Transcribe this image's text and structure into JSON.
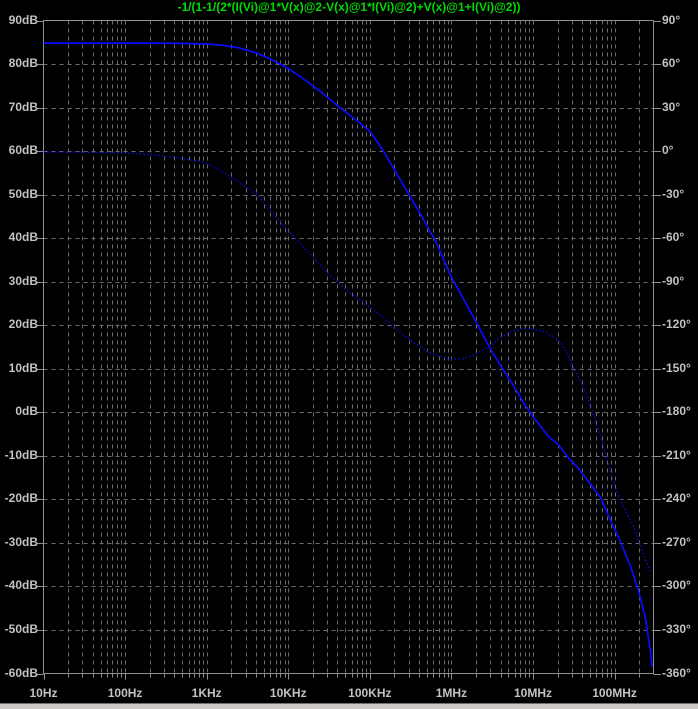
{
  "title": {
    "text": "-1/(1-1/(2*(I(Vi)@1*V(x)@2-V(x)@1*I(Vi)@2)+V(x)@1+I(Vi)@2))",
    "color": "#00dc00"
  },
  "colors": {
    "background": "#000000",
    "trace_blue": "#0b0bff",
    "grid": "#6e6e6e",
    "axis_border": "#909090",
    "tick": "#909090",
    "label": "#c2c2c2",
    "bottom_strip": "#cdcac5"
  },
  "chart_data": {
    "type": "line",
    "title": "-1/(1-1/(2*(I(Vi)@1*V(x)@2-V(x)@1*I(Vi)@2)+V(x)@1+I(Vi)@2))",
    "x_axis": {
      "scale": "log",
      "unit": "Hz",
      "log10_range": [
        1.0,
        8.4771
      ],
      "tick_labels": [
        "10Hz",
        "100Hz",
        "1KHz",
        "10KHz",
        "100KHz",
        "1MHz",
        "10MHz",
        "100MHz"
      ],
      "tick_log10_positions": [
        1,
        2,
        3,
        4,
        5,
        6,
        7,
        8
      ]
    },
    "y_axis_left": {
      "unit": "dB",
      "range": [
        -60,
        90
      ],
      "step": 10,
      "tick_labels": [
        "90dB",
        "80dB",
        "70dB",
        "60dB",
        "50dB",
        "40dB",
        "30dB",
        "20dB",
        "10dB",
        "0dB",
        "-10dB",
        "-20dB",
        "-30dB",
        "-40dB",
        "-50dB",
        "-60dB"
      ]
    },
    "y_axis_right": {
      "unit": "degrees",
      "range": [
        -360,
        90
      ],
      "step": 30,
      "tick_labels": [
        "90°",
        "60°",
        "30°",
        "0°",
        "-30°",
        "-60°",
        "-90°",
        "-120°",
        "-150°",
        "-180°",
        "-210°",
        "-240°",
        "-270°",
        "-300°",
        "-330°",
        "-360°"
      ]
    },
    "grid": {
      "horizontal": true,
      "vertical_major": true,
      "vertical_minor_log": true,
      "style": "dashed"
    },
    "legend": "none",
    "series": [
      {
        "name": "magnitude",
        "axis": "left",
        "style": "solid",
        "color": "#0b0bff",
        "points_log10f_db": [
          [
            1.0,
            84.8
          ],
          [
            1.5,
            84.8
          ],
          [
            2.0,
            84.8
          ],
          [
            2.4,
            84.8
          ],
          [
            2.7,
            84.75
          ],
          [
            3.0,
            84.6
          ],
          [
            3.2,
            84.3
          ],
          [
            3.4,
            83.7
          ],
          [
            3.6,
            82.6
          ],
          [
            3.8,
            81.0
          ],
          [
            4.0,
            79.0
          ],
          [
            4.2,
            76.4
          ],
          [
            4.4,
            73.6
          ],
          [
            4.6,
            70.5
          ],
          [
            4.8,
            67.6
          ],
          [
            5.0,
            64.6
          ],
          [
            5.15,
            60.5
          ],
          [
            5.3,
            55.8
          ],
          [
            5.45,
            51.0
          ],
          [
            5.6,
            46.2
          ],
          [
            5.7,
            42.8
          ],
          [
            5.8,
            39.6
          ],
          [
            5.9,
            35.3
          ],
          [
            6.0,
            31.0
          ],
          [
            6.15,
            26.0
          ],
          [
            6.3,
            20.8
          ],
          [
            6.48,
            14.5
          ],
          [
            6.6,
            10.8
          ],
          [
            6.75,
            6.4
          ],
          [
            6.9,
            1.8
          ],
          [
            7.0,
            -1.0
          ],
          [
            7.1,
            -3.4
          ],
          [
            7.2,
            -5.8
          ],
          [
            7.3,
            -7.2
          ],
          [
            7.45,
            -10.8
          ],
          [
            7.55,
            -12.7
          ],
          [
            7.7,
            -16.4
          ],
          [
            7.83,
            -19.6
          ],
          [
            7.95,
            -24.8
          ],
          [
            8.07,
            -29.6
          ],
          [
            8.2,
            -35.6
          ],
          [
            8.3,
            -41.5
          ],
          [
            8.38,
            -47.5
          ],
          [
            8.44,
            -55.0
          ],
          [
            8.46,
            -58.5
          ]
        ]
      },
      {
        "name": "phase",
        "axis": "right",
        "style": "dotted",
        "color": "#0b0bff",
        "points_log10f_deg": [
          [
            1.0,
            -0.6
          ],
          [
            1.6,
            -0.8
          ],
          [
            2.0,
            -1.3
          ],
          [
            2.3,
            -2.3
          ],
          [
            2.6,
            -4.2
          ],
          [
            2.92,
            -7.0
          ],
          [
            3.1,
            -11.0
          ],
          [
            3.33,
            -19.0
          ],
          [
            3.62,
            -30.0
          ],
          [
            3.8,
            -42.0
          ],
          [
            4.0,
            -55.0
          ],
          [
            4.15,
            -64.0
          ],
          [
            4.3,
            -72.5
          ],
          [
            4.48,
            -84.0
          ],
          [
            4.76,
            -98.0
          ],
          [
            5.0,
            -107.5
          ],
          [
            5.13,
            -113.0
          ],
          [
            5.35,
            -124.0
          ],
          [
            5.56,
            -133.0
          ],
          [
            5.75,
            -139.5
          ],
          [
            5.95,
            -143.0
          ],
          [
            6.11,
            -143.5
          ],
          [
            6.25,
            -141.0
          ],
          [
            6.36,
            -138.0
          ],
          [
            6.48,
            -134.0
          ],
          [
            6.6,
            -128.5
          ],
          [
            6.75,
            -124.0
          ],
          [
            6.88,
            -122.5
          ],
          [
            7.0,
            -122.8
          ],
          [
            7.13,
            -124.2
          ],
          [
            7.25,
            -128.0
          ],
          [
            7.34,
            -132.0
          ],
          [
            7.45,
            -143.0
          ],
          [
            7.52,
            -152.0
          ],
          [
            7.62,
            -163.0
          ],
          [
            7.72,
            -178.0
          ],
          [
            7.83,
            -197.0
          ],
          [
            7.92,
            -215.0
          ],
          [
            8.01,
            -232.0
          ],
          [
            8.1,
            -244.0
          ],
          [
            8.22,
            -257.0
          ],
          [
            8.3,
            -269.0
          ],
          [
            8.38,
            -282.0
          ],
          [
            8.44,
            -290.0
          ]
        ]
      }
    ]
  }
}
